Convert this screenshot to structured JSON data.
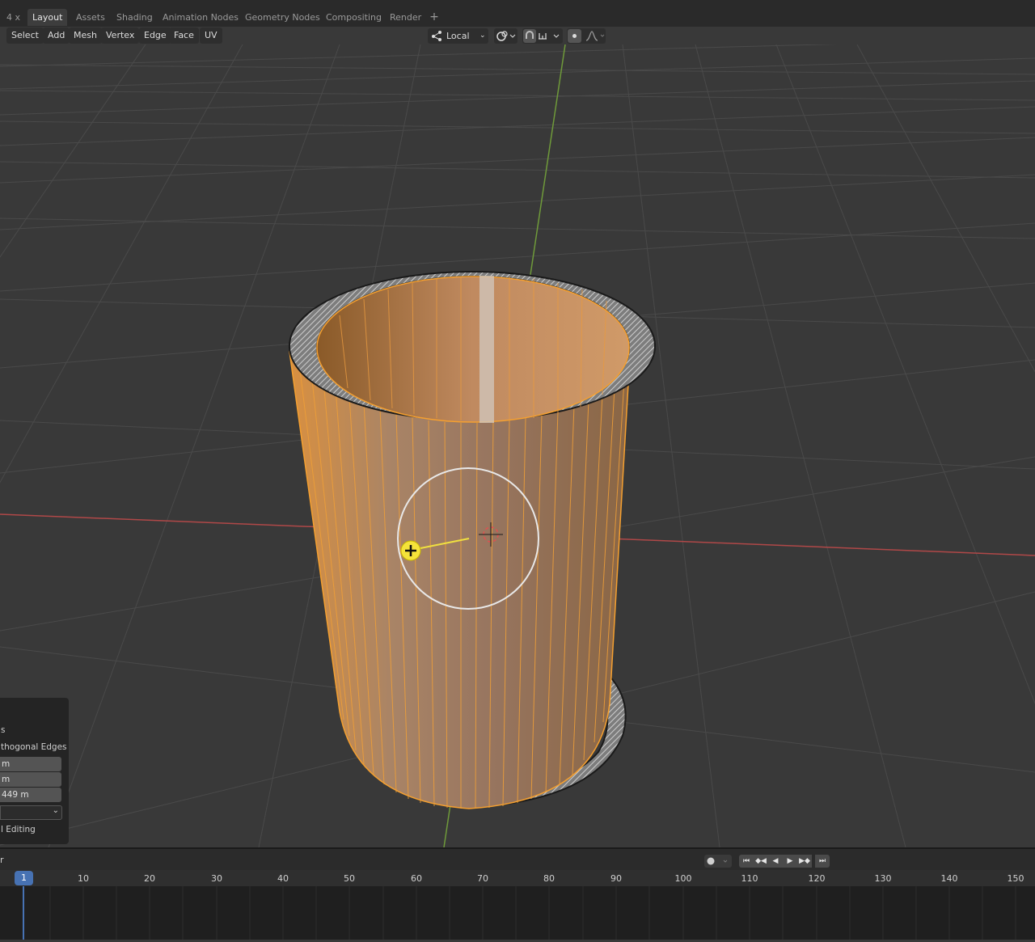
{
  "topbar": {
    "tabs": [
      {
        "label": "4 x",
        "active": false
      },
      {
        "label": "Layout",
        "active": true
      },
      {
        "label": "Assets",
        "active": false
      },
      {
        "label": "Shading",
        "active": false
      },
      {
        "label": "Animation Nodes",
        "active": false
      },
      {
        "label": "Geometry Nodes",
        "active": false
      },
      {
        "label": "Compositing",
        "active": false
      },
      {
        "label": "Render",
        "active": false
      }
    ],
    "add_tab": "+"
  },
  "viewport_header": {
    "menus": [
      "Select",
      "Add",
      "Mesh",
      "Vertex",
      "Edge",
      "Face",
      "UV"
    ],
    "transform_orientation": "Local"
  },
  "last_operator_panel": {
    "option_fragment": "s",
    "orthogonal_label": "thogonal Edges",
    "fields": [
      "m",
      "m",
      "449 m"
    ],
    "editing_label": "l Editing"
  },
  "timeline": {
    "header_fragment": "r",
    "current_frame": "1",
    "ticks": [
      "10",
      "20",
      "30",
      "40",
      "50",
      "60",
      "70",
      "80",
      "90",
      "100",
      "110",
      "120",
      "130",
      "140",
      "150"
    ]
  },
  "colors": {
    "accent_blue": "#4772b3",
    "selection_orange": "#f5a030",
    "grid_x_axis": "#c25454",
    "grid_y_axis": "#7ca04a"
  }
}
